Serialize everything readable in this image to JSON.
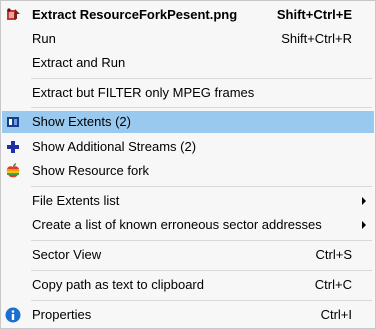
{
  "menu": {
    "items": [
      {
        "label": "Extract ResourceForkPesent.png",
        "shortcut": "Shift+Ctrl+E",
        "bold": true,
        "icon": "extract-icon"
      },
      {
        "label": "Run",
        "shortcut": "Shift+Ctrl+R"
      },
      {
        "label": "Extract and Run",
        "shortcut": ""
      },
      {
        "label": "Extract but FILTER only MPEG frames",
        "shortcut": ""
      },
      {
        "label": "Show Extents (2)",
        "shortcut": "",
        "icon": "extents-icon",
        "highlighted": true
      },
      {
        "label": "Show Additional Streams (2)",
        "shortcut": "",
        "icon": "plus-icon"
      },
      {
        "label": "Show Resource fork",
        "shortcut": "",
        "icon": "apple-icon"
      },
      {
        "label": "File Extents list",
        "shortcut": "",
        "submenu": true
      },
      {
        "label": "Create a list of known erroneous sector addresses",
        "shortcut": "",
        "submenu": true
      },
      {
        "label": "Sector View",
        "shortcut": "Ctrl+S"
      },
      {
        "label": "Copy path as text to clipboard",
        "shortcut": "Ctrl+C"
      },
      {
        "label": "Properties",
        "shortcut": "Ctrl+I",
        "icon": "info-icon"
      }
    ]
  },
  "colors": {
    "highlight": "#99c9ef",
    "menu_background": "#f7f7f7",
    "separator": "#d9d9d9"
  }
}
